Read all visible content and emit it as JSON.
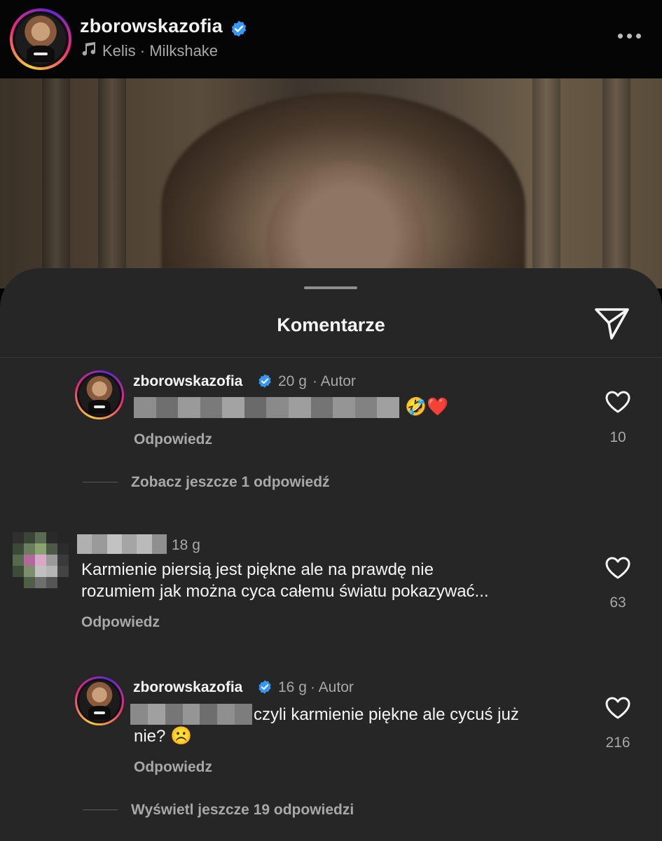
{
  "header": {
    "username": "zborowskazofia",
    "music": "Kelis · Milkshake"
  },
  "sheet": {
    "title": "Komentarze"
  },
  "comments": [
    {
      "username": "zborowskazofia",
      "time": "20 g",
      "badge": "· Autor",
      "emojis": "🤣❤️",
      "reply_label": "Odpowiedz",
      "likes": "10",
      "more_replies": "Zobacz jeszcze 1 odpowiedź"
    },
    {
      "time": "18 g",
      "text_line1": "Karmienie piersią jest piękne ale na prawdę nie",
      "text_line2": "rozumiem jak można cyca całemu światu pokazywać...",
      "reply_label": "Odpowiedz",
      "likes": "63"
    },
    {
      "username": "zborowskazofia",
      "time": "16 g",
      "badge": "· Autor",
      "text_line1": "czyli karmienie piękne ale cycuś już",
      "text_line2": "nie?",
      "emoji": "☹️",
      "reply_label": "Odpowiedz",
      "likes": "216",
      "more_replies": "Wyświetl jeszcze 19 odpowiedzi"
    }
  ],
  "colors": {
    "sheet_bg": "#262626",
    "verified_blue": "#3897f0",
    "secondary_text": "#a8a8a8"
  },
  "icons": [
    "more-icon",
    "music-note-icon",
    "verified-icon",
    "share-icon",
    "heart-icon"
  ]
}
